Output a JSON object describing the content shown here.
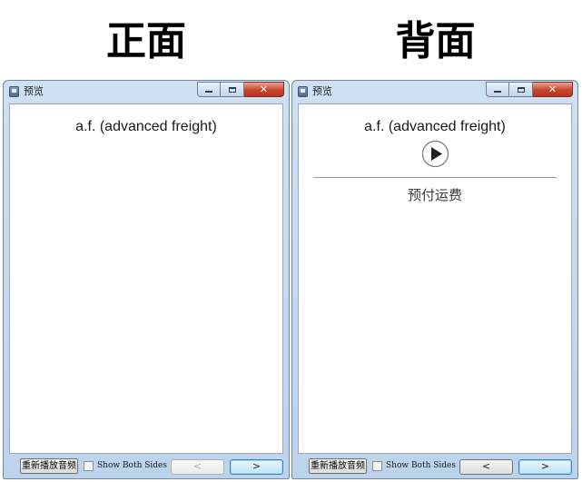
{
  "headings": {
    "front": "正面",
    "back": "背面"
  },
  "windows": [
    {
      "title": "预览",
      "titlebar_buttons": {
        "minimize": "minimize",
        "maximize": "maximize",
        "close": "✕"
      },
      "card": {
        "question": "a.f. (advanced freight)"
      },
      "bottom": {
        "replay_label": "重新播放音频",
        "show_both_sides_label": "Show Both Sides",
        "show_both_sides_checked": false,
        "prev_label": "<",
        "prev_enabled": false,
        "next_label": ">"
      }
    },
    {
      "title": "预览",
      "titlebar_buttons": {
        "minimize": "minimize",
        "maximize": "maximize",
        "close": "✕"
      },
      "card": {
        "question": "a.f. (advanced freight)",
        "play_icon": "play-circle-icon",
        "answer": "预付运费"
      },
      "bottom": {
        "replay_label": "重新播放音频",
        "show_both_sides_label": "Show Both Sides",
        "show_both_sides_checked": false,
        "prev_label": "<",
        "prev_enabled": true,
        "next_label": ">"
      }
    }
  ],
  "colors": {
    "window_frame": "#bcd3ec",
    "close_button": "#c7452c",
    "focused_button": "#bfe3f7"
  }
}
